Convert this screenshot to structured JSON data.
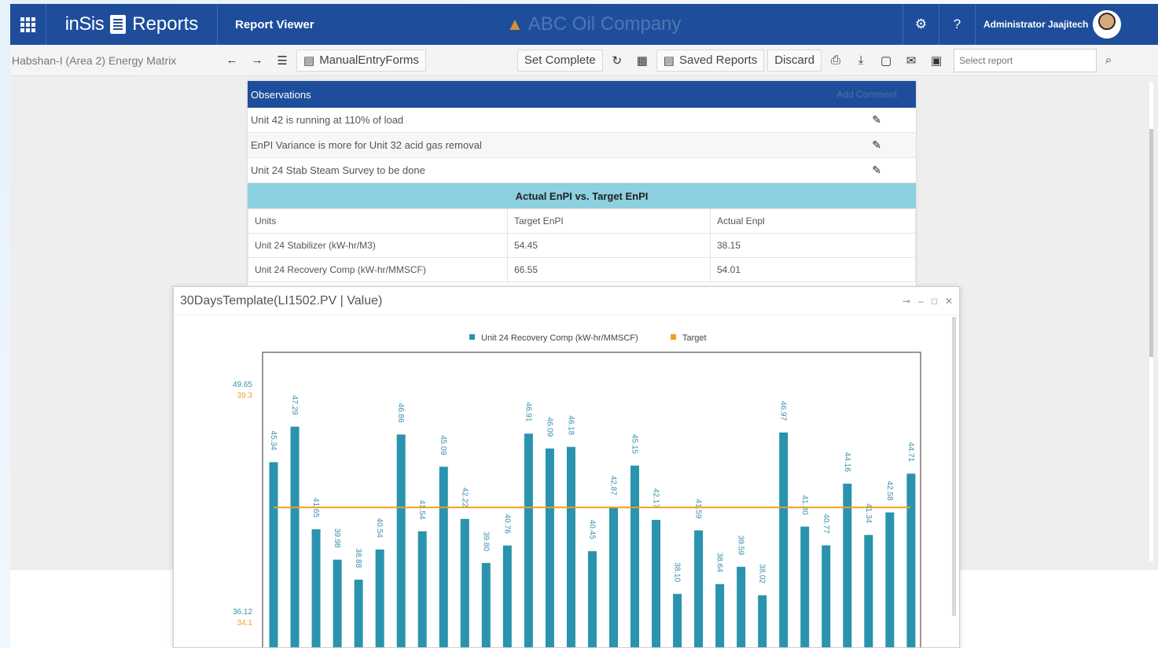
{
  "header": {
    "brand_logo": "inSis",
    "brand_reports": "Reports",
    "viewer_title": "Report Viewer",
    "company": "ABC Oil Company",
    "user_name": "Administrator Jaajitech"
  },
  "toolbar": {
    "breadcrumb": "Habshan-I (Area 2) Energy Matrix",
    "manual_entry": "ManualEntryForms",
    "set_complete": "Set Complete",
    "saved_reports": "Saved Reports",
    "discard": "Discard",
    "search_placeholder": "Select report"
  },
  "observations": {
    "title": "Observations",
    "add_label": "Add Comment",
    "items": [
      "Unit 42 is running at 110% of load",
      "EnPI Variance is more for Unit 32 acid gas removal",
      "Unit 24 Stab Steam Survey to be done"
    ]
  },
  "enpi": {
    "title": "Actual EnPI vs. Target EnPI",
    "columns": [
      "Units",
      "Target EnPI",
      "Actual Enpl"
    ],
    "rows": [
      [
        "Unit 24 Stabilizer (kW-hr/M3)",
        "54.45",
        "38.15"
      ],
      [
        "Unit 24 Recovery Comp (kW-hr/MMSCF)",
        "66.55",
        "54.01"
      ]
    ]
  },
  "chart_window": {
    "title": "30DaysTemplate(LI1502.PV | Value)"
  },
  "chart_data": {
    "type": "bar",
    "series": [
      {
        "name": "Unit 24 Recovery Comp (kW-hr/MMSCF)",
        "color": "#2a93ad",
        "values": [
          45.34,
          47.29,
          41.65,
          39.98,
          38.88,
          40.54,
          46.86,
          41.54,
          45.09,
          42.22,
          39.8,
          40.76,
          46.91,
          46.09,
          46.18,
          40.45,
          42.87,
          45.15,
          42.17,
          38.1,
          41.59,
          38.64,
          39.59,
          38.02,
          46.97,
          41.8,
          40.77,
          44.16,
          41.34,
          42.58,
          44.71
        ]
      },
      {
        "name": "Target",
        "color": "#f0a020",
        "value": 42.85
      }
    ],
    "ylim": [
      36.12,
      49.65
    ],
    "y_ticks_primary": [
      "49.65",
      "36.12"
    ],
    "y_ticks_secondary": [
      "39.3",
      "34.1"
    ],
    "legend": "top-center"
  }
}
